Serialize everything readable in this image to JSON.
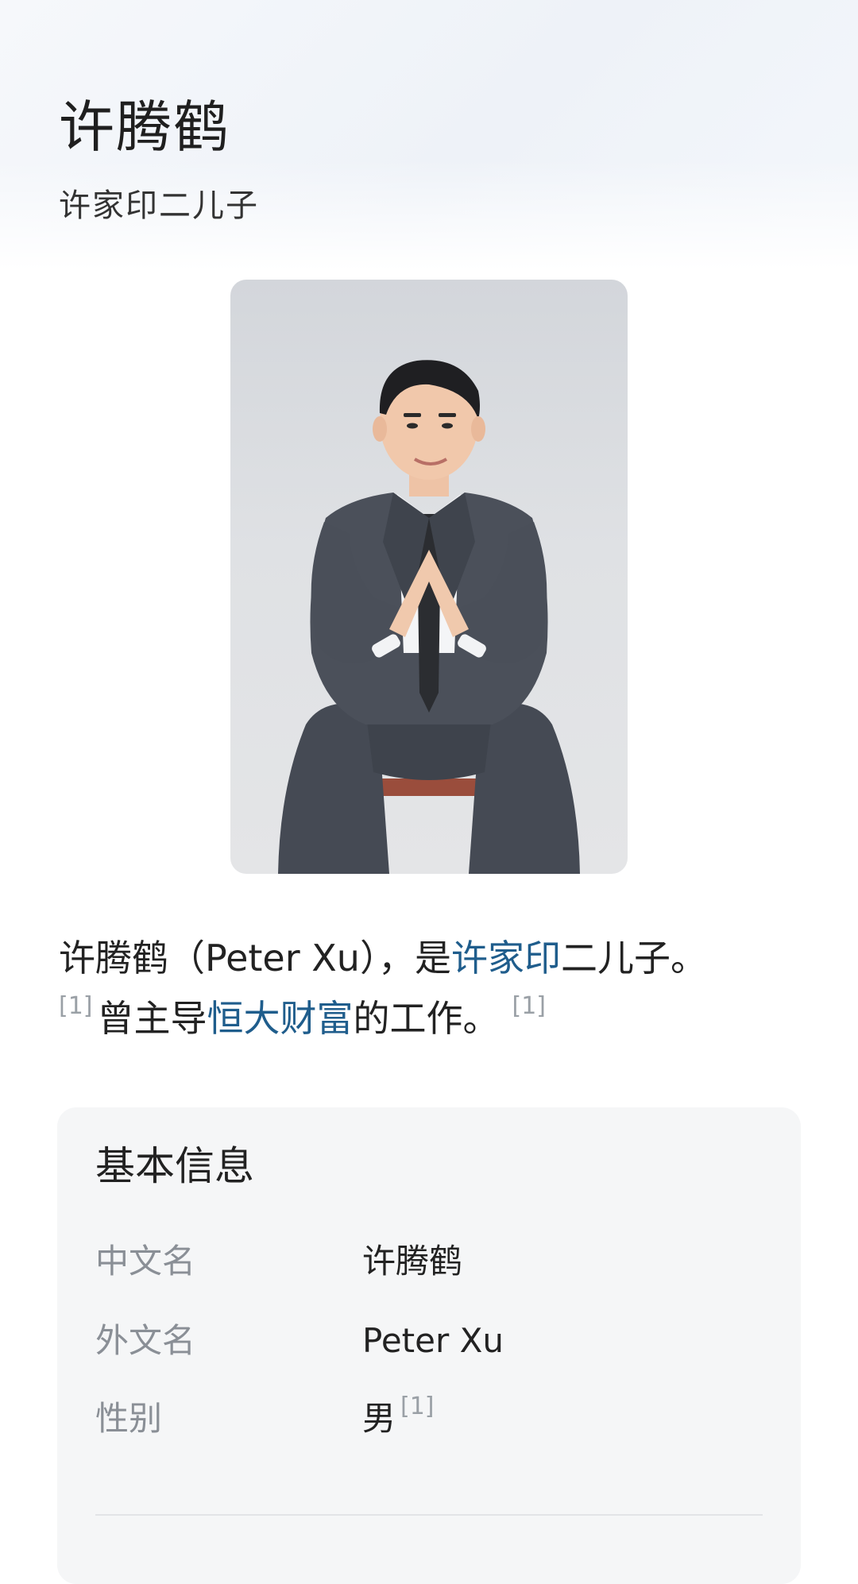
{
  "header": {
    "title": "许腾鹤",
    "subtitle": "许家印二儿子"
  },
  "summary": {
    "p1": "许腾鹤（Peter Xu），是",
    "link1": "许家印",
    "p2": "二儿子。",
    "ref1": "[1]",
    "p3": "曾主导",
    "link2": "恒大财富",
    "p4": "的工作。",
    "ref2": "[1]"
  },
  "info": {
    "title": "基本信息",
    "rows": [
      {
        "label": "中文名",
        "value": "许腾鹤"
      },
      {
        "label": "外文名",
        "value": "Peter Xu"
      },
      {
        "label": "性别",
        "value": "男",
        "ref": "[1]"
      }
    ]
  },
  "colors": {
    "link": "#1f5d8c",
    "ref": "#9aa0a6",
    "card_bg": "#f5f6f7",
    "label": "#8a8f96"
  }
}
